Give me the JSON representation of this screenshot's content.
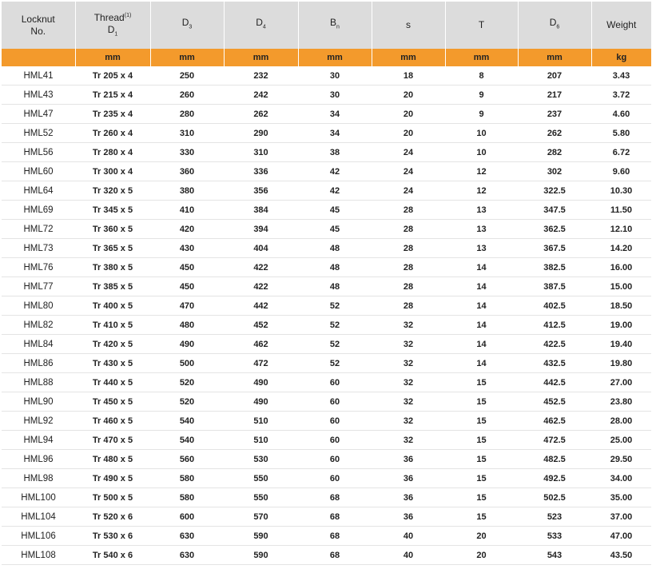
{
  "table": {
    "headers": [
      {
        "line1": "Locknut",
        "line2": "No.",
        "sup": "",
        "sub": ""
      },
      {
        "line1": "Thread",
        "line2": "D",
        "sup": "(1)",
        "sub": "1"
      },
      {
        "line1": "D",
        "line2": "",
        "sup": "",
        "sub": "3"
      },
      {
        "line1": "D",
        "line2": "",
        "sup": "",
        "sub": "4"
      },
      {
        "line1": "B",
        "line2": "",
        "sup": "",
        "sub": "n"
      },
      {
        "line1": "s",
        "line2": "",
        "sup": "",
        "sub": ""
      },
      {
        "line1": "T",
        "line2": "",
        "sup": "",
        "sub": ""
      },
      {
        "line1": "D",
        "line2": "",
        "sup": "",
        "sub": "6"
      },
      {
        "line1": "Weight",
        "line2": "",
        "sup": "",
        "sub": ""
      }
    ],
    "units": [
      "",
      "mm",
      "mm",
      "mm",
      "mm",
      "mm",
      "mm",
      "mm",
      "kg"
    ],
    "rows": [
      [
        "HML41",
        "Tr 205 x 4",
        "250",
        "232",
        "30",
        "18",
        "8",
        "207",
        "3.43"
      ],
      [
        "HML43",
        "Tr 215 x 4",
        "260",
        "242",
        "30",
        "20",
        "9",
        "217",
        "3.72"
      ],
      [
        "HML47",
        "Tr 235 x 4",
        "280",
        "262",
        "34",
        "20",
        "9",
        "237",
        "4.60"
      ],
      [
        "HML52",
        "Tr 260 x 4",
        "310",
        "290",
        "34",
        "20",
        "10",
        "262",
        "5.80"
      ],
      [
        "HML56",
        "Tr 280 x 4",
        "330",
        "310",
        "38",
        "24",
        "10",
        "282",
        "6.72"
      ],
      [
        "HML60",
        "Tr 300 x 4",
        "360",
        "336",
        "42",
        "24",
        "12",
        "302",
        "9.60"
      ],
      [
        "HML64",
        "Tr 320 x 5",
        "380",
        "356",
        "42",
        "24",
        "12",
        "322.5",
        "10.30"
      ],
      [
        "HML69",
        "Tr 345 x 5",
        "410",
        "384",
        "45",
        "28",
        "13",
        "347.5",
        "11.50"
      ],
      [
        "HML72",
        "Tr 360 x 5",
        "420",
        "394",
        "45",
        "28",
        "13",
        "362.5",
        "12.10"
      ],
      [
        "HML73",
        "Tr 365 x 5",
        "430",
        "404",
        "48",
        "28",
        "13",
        "367.5",
        "14.20"
      ],
      [
        "HML76",
        "Tr 380 x 5",
        "450",
        "422",
        "48",
        "28",
        "14",
        "382.5",
        "16.00"
      ],
      [
        "HML77",
        "Tr 385 x 5",
        "450",
        "422",
        "48",
        "28",
        "14",
        "387.5",
        "15.00"
      ],
      [
        "HML80",
        "Tr 400 x 5",
        "470",
        "442",
        "52",
        "28",
        "14",
        "402.5",
        "18.50"
      ],
      [
        "HML82",
        "Tr 410 x 5",
        "480",
        "452",
        "52",
        "32",
        "14",
        "412.5",
        "19.00"
      ],
      [
        "HML84",
        "Tr 420 x 5",
        "490",
        "462",
        "52",
        "32",
        "14",
        "422.5",
        "19.40"
      ],
      [
        "HML86",
        "Tr 430 x 5",
        "500",
        "472",
        "52",
        "32",
        "14",
        "432.5",
        "19.80"
      ],
      [
        "HML88",
        "Tr 440 x 5",
        "520",
        "490",
        "60",
        "32",
        "15",
        "442.5",
        "27.00"
      ],
      [
        "HML90",
        "Tr 450 x 5",
        "520",
        "490",
        "60",
        "32",
        "15",
        "452.5",
        "23.80"
      ],
      [
        "HML92",
        "Tr 460 x 5",
        "540",
        "510",
        "60",
        "32",
        "15",
        "462.5",
        "28.00"
      ],
      [
        "HML94",
        "Tr 470 x 5",
        "540",
        "510",
        "60",
        "32",
        "15",
        "472.5",
        "25.00"
      ],
      [
        "HML96",
        "Tr 480 x 5",
        "560",
        "530",
        "60",
        "36",
        "15",
        "482.5",
        "29.50"
      ],
      [
        "HML98",
        "Tr 490 x 5",
        "580",
        "550",
        "60",
        "36",
        "15",
        "492.5",
        "34.00"
      ],
      [
        "HML100",
        "Tr 500 x 5",
        "580",
        "550",
        "68",
        "36",
        "15",
        "502.5",
        "35.00"
      ],
      [
        "HML104",
        "Tr 520 x 6",
        "600",
        "570",
        "68",
        "36",
        "15",
        "523",
        "37.00"
      ],
      [
        "HML106",
        "Tr 530 x 6",
        "630",
        "590",
        "68",
        "40",
        "20",
        "533",
        "47.00"
      ],
      [
        "HML108",
        "Tr 540 x 6",
        "630",
        "590",
        "68",
        "40",
        "20",
        "543",
        "43.50"
      ]
    ]
  }
}
